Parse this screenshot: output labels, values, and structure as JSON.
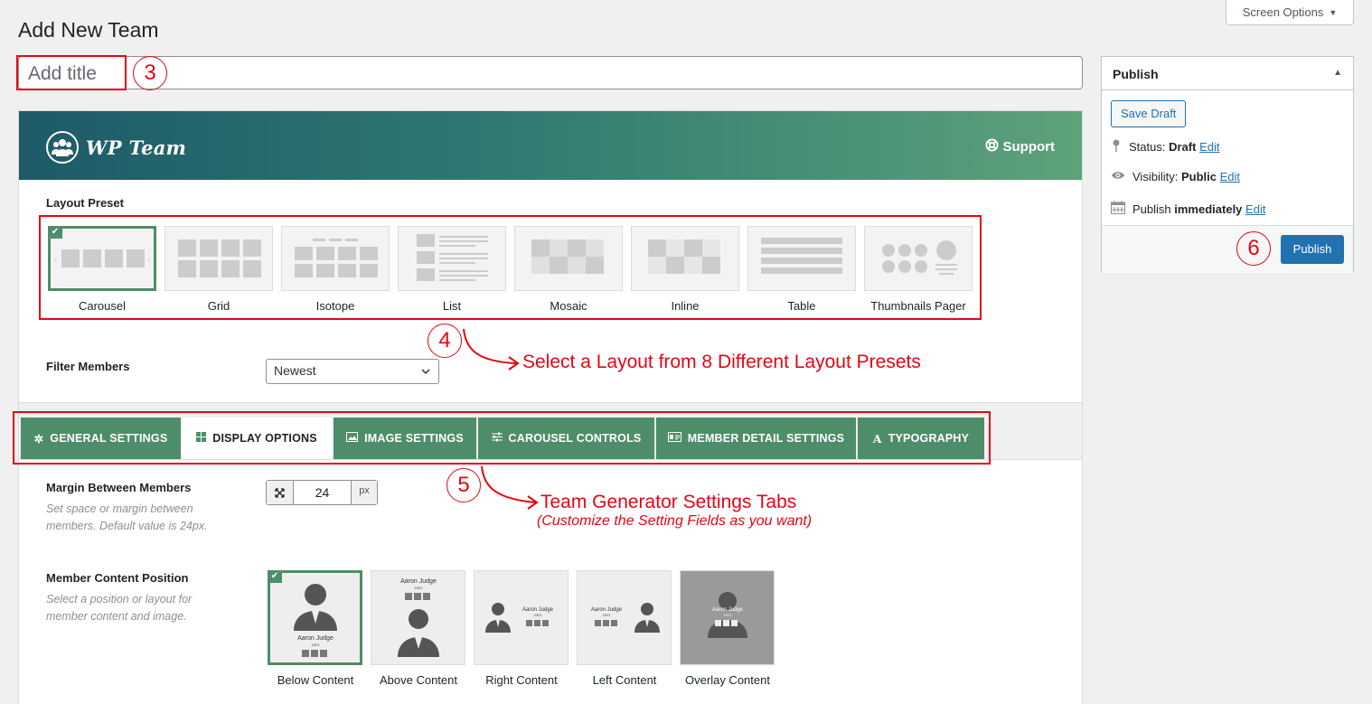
{
  "header": {
    "screen_options": "Screen Options",
    "title": "Add New Team"
  },
  "title_input": {
    "placeholder": "Add title"
  },
  "banner": {
    "brand": "WP Team",
    "support": "Support"
  },
  "layout_preset": {
    "label": "Layout Preset",
    "items": [
      "Carousel",
      "Grid",
      "Isotope",
      "List",
      "Mosaic",
      "Inline",
      "Table",
      "Thumbnails Pager"
    ]
  },
  "filter": {
    "label": "Filter Members",
    "value": "Newest"
  },
  "tabs": [
    "GENERAL SETTINGS",
    "DISPLAY OPTIONS",
    "IMAGE SETTINGS",
    "CAROUSEL CONTROLS",
    "MEMBER DETAIL SETTINGS",
    "TYPOGRAPHY"
  ],
  "margin": {
    "label": "Margin Between Members",
    "help1": "Set space or margin between",
    "help2": "members. Default value is 24px.",
    "value": "24",
    "unit": "px"
  },
  "content_position": {
    "label": "Member Content Position",
    "help1": "Select a position or layout for",
    "help2": "member content and image.",
    "items": [
      "Below Content",
      "Above Content",
      "Right Content",
      "Left Content",
      "Overlay Content"
    ],
    "sample_name": "Aaron Judge",
    "sample_role": "CEO"
  },
  "publish": {
    "title": "Publish",
    "save_draft": "Save Draft",
    "status_label": "Status:",
    "status_value": "Draft",
    "visibility_label": "Visibility:",
    "visibility_value": "Public",
    "schedule_label": "Publish",
    "schedule_value": "immediately",
    "edit": "Edit",
    "publish_button": "Publish"
  },
  "annotations": {
    "n3": "3",
    "n4": "4",
    "n5": "5",
    "n6": "6",
    "layout_note": "Select a Layout from 8 Different Layout Presets",
    "tabs_note": "Team Generator Settings Tabs",
    "tabs_sub": "(Customize the Setting Fields as you want)"
  },
  "colors": {
    "accent_green": "#4e8d69",
    "wp_blue": "#2271b1",
    "annotation_red": "#e30613"
  }
}
